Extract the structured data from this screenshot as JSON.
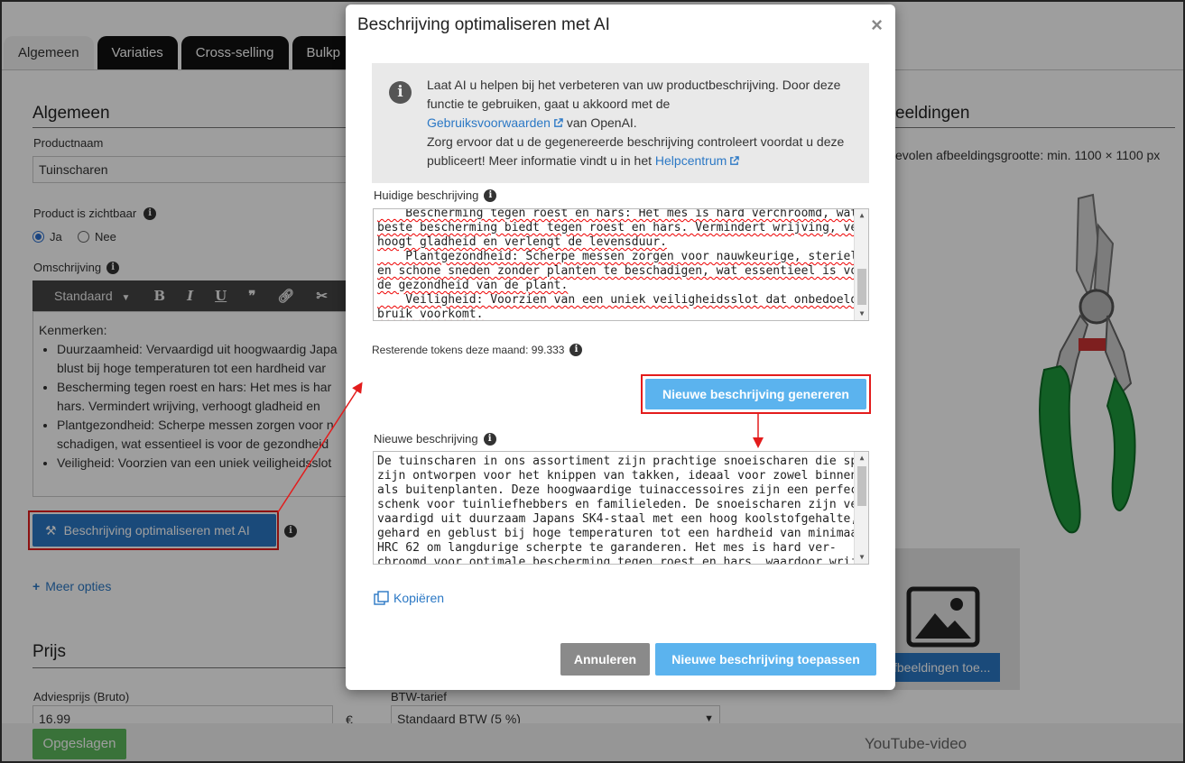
{
  "tabs": [
    {
      "label": "Algemeen",
      "active": true
    },
    {
      "label": "Variaties",
      "active": false
    },
    {
      "label": "Cross-selling",
      "active": false
    },
    {
      "label": "Bulkp",
      "active": false
    }
  ],
  "general": {
    "section_title": "Algemeen",
    "productname_label": "Productnaam",
    "productname_value": "Tuinscharen",
    "visible_label": "Product is zichtbaar",
    "visible_yes": "Ja",
    "visible_no": "Nee",
    "description_label": "Omschrijving",
    "editor_style": "Standaard",
    "editor_heading": "Kenmerken:",
    "editor_items": [
      "Duurzaamheid: Vervaardigd uit hoogwaardig Japa",
      "blust bij hoge temperaturen tot een hardheid var",
      "Bescherming tegen roest en hars: Het mes is har",
      "hars. Vermindert wrijving, verhoogt gladheid en",
      "Plantgezondheid: Scherpe messen zorgen voor n",
      "schadigen, wat essentieel is voor de gezondheid",
      "Veiligheid: Voorzien van een uniek veiligheidsslot"
    ],
    "optimize_button": "Beschrijving optimaliseren met AI",
    "more_options": "Meer opties"
  },
  "price": {
    "section_title": "Prijs",
    "advice_label": "Adviesprijs (Bruto)",
    "advice_value": "16,99",
    "currency": "€",
    "vat_label": "BTW-tarief",
    "vat_value": "Standaard BTW (5 %)"
  },
  "images": {
    "section_title": "eeldingen",
    "hint": "evolen afbeeldingsgrootte: min. 1100 × 1100 px",
    "upload_button": "fbeeldingen toe..."
  },
  "footer": {
    "saved_button": "Opgeslagen",
    "youtube_label": "YouTube-video"
  },
  "modal": {
    "title": "Beschrijving optimaliseren met AI",
    "close": "×",
    "info_line1": "Laat AI u helpen bij het verbeteren van uw productbeschrijving. Door deze functie te gebruiken, gaat u akkoord met de",
    "info_terms_link": "Gebruiksvoorwaarden",
    "info_line1_end": "van OpenAI.",
    "info_line2": "Zorg ervoor dat u de gegenereerde beschrijving controleert voordat u deze publiceert! Meer informatie vindt u in het",
    "info_help_link": "Helpcentrum",
    "current_label": "Huidige beschrijving",
    "current_text": [
      "    Bescherming tegen roest en hars: Het mes is hard verchroomd, wat de",
      "beste bescherming biedt tegen roest en hars. Vermindert wrijving, ver-",
      "hoogt gladheid en verlengt de levensduur.",
      "    Plantgezondheid: Scherpe messen zorgen voor nauwkeurige, steriele",
      "en schone sneden zonder planten te beschadigen, wat essentieel is voor",
      "de gezondheid van de plant.",
      "    Veiligheid: Voorzien van een uniek veiligheidsslot dat onbedoeld ge-",
      "bruik voorkomt."
    ],
    "tokens_text": "Resterende tokens deze maand: 99.333",
    "generate_button": "Nieuwe beschrijving genereren",
    "new_label": "Nieuwe beschrijving",
    "new_text": [
      "De tuinscharen in ons assortiment zijn prachtige snoeischaren die speciaal",
      "zijn ontworpen voor het knippen van takken, ideaal voor zowel binnen-",
      "als buitenplanten. Deze hoogwaardige tuinaccessoires zijn een perfect ge-",
      "schenk voor tuinliefhebbers en familieleden. De snoeischaren zijn ver-",
      "vaardigd uit duurzaam Japans SK4-staal met een hoog koolstofgehalte,",
      "gehard en geblust bij hoge temperaturen tot een hardheid van minimaal",
      "HRC 62 om langdurige scherpte te garanderen. Het mes is hard ver-",
      "chroomd voor optimale bescherming tegen roest en hars, waardoor wrij-"
    ],
    "copy_link": "Kopiëren",
    "cancel_button": "Annuleren",
    "apply_button": "Nieuwe beschrijving toepassen"
  },
  "colors": {
    "primary_blue": "#2b78c5",
    "light_blue": "#5bb3ee",
    "success_green": "#5cb85c",
    "highlight_red": "#e31c1c",
    "cancel_gray": "#8a8a8a"
  }
}
